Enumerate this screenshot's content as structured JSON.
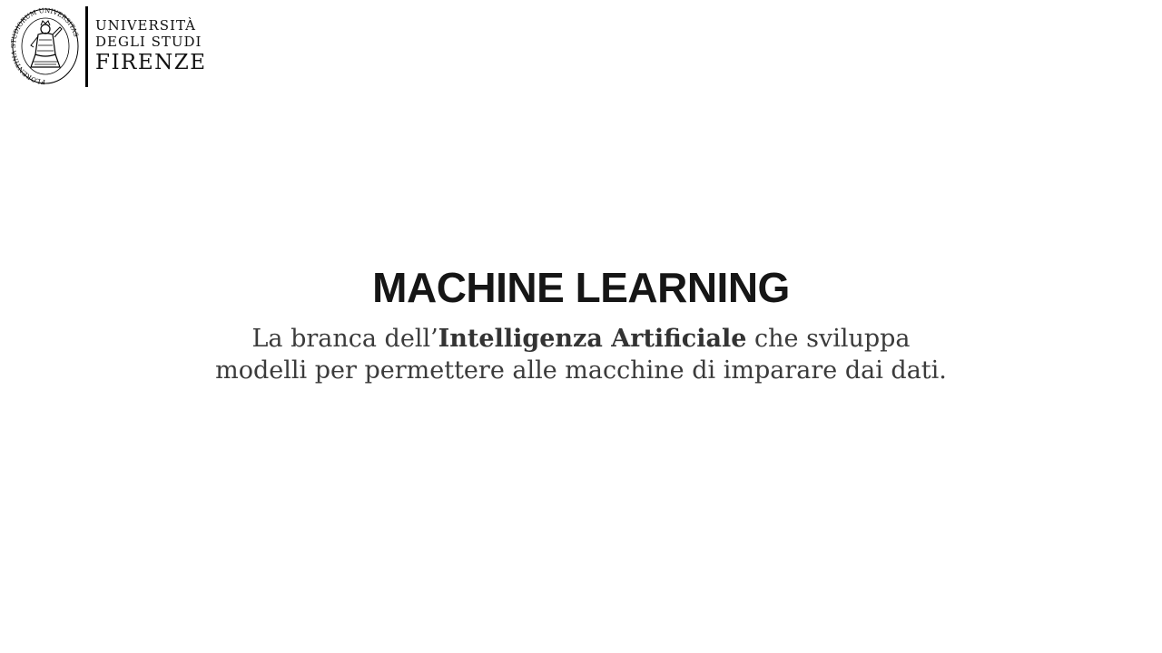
{
  "logo": {
    "seal_ring_text": "FLORENTINA STUDIORUM UNIVERSITAS",
    "line1": "UNIVERSITÀ",
    "line2": "DEGLI STUDI",
    "line3": "FIRENZE"
  },
  "slide": {
    "title": "MACHINE LEARNING",
    "subtitle_part1": "La branca dell’",
    "subtitle_bold": "Intelligenza Artificiale",
    "subtitle_part2": " che sviluppa modelli per permettere alle macchine di imparare dai dati."
  },
  "colors": {
    "background": "#ffffff",
    "title": "#161616",
    "subtitle": "#3b3b3b",
    "logo": "#000000"
  }
}
